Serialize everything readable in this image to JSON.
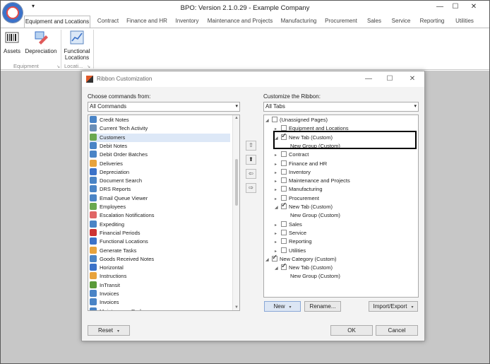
{
  "app": {
    "title": "BPO: Version 2.1.0.29 - Example Company",
    "qat_arrow": "▾",
    "window_controls": {
      "minimize": "—",
      "maximize": "☐",
      "close": "✕"
    }
  },
  "ribbon": {
    "tabs": [
      "Equipment and Locations",
      "Contract",
      "Finance and HR",
      "Inventory",
      "Maintenance and Projects",
      "Manufacturing",
      "Procurement",
      "Sales",
      "Service",
      "Reporting",
      "Utilities"
    ],
    "buttons": {
      "assets": "Assets",
      "depreciation": "Depreciation",
      "functional_locations_1": "Functional",
      "functional_locations_2": "Locations"
    },
    "groups": {
      "equipment": "Equipment",
      "locations": "Locati..."
    },
    "launcher": "↘"
  },
  "dialog": {
    "title": "Ribbon Customization",
    "controls": {
      "minimize": "—",
      "maximize": "☐",
      "close": "✕"
    },
    "left_label": "Choose commands from:",
    "left_combo": "All Commands",
    "right_label": "Customize the Ribbon:",
    "right_combo": "All Tabs",
    "commands": [
      {
        "label": "Credit Notes",
        "color": "#4a84c6"
      },
      {
        "label": "Current Tech Activity",
        "color": "#6b8fb8"
      },
      {
        "label": "Customers",
        "color": "#6aa84f"
      },
      {
        "label": "Debit Notes",
        "color": "#4a84c6"
      },
      {
        "label": "Debit Order Batches",
        "color": "#4a84c6"
      },
      {
        "label": "Deliveries",
        "color": "#e8a33d"
      },
      {
        "label": "Depreciation",
        "color": "#3b72c9"
      },
      {
        "label": "Document Search",
        "color": "#4a84c6"
      },
      {
        "label": "DRS Reports",
        "color": "#4a84c6"
      },
      {
        "label": "Email Queue Viewer",
        "color": "#4a84c6"
      },
      {
        "label": "Employees",
        "color": "#6aa84f"
      },
      {
        "label": "Escalation Notifications",
        "color": "#e06666"
      },
      {
        "label": "Expediting",
        "color": "#4a84c6"
      },
      {
        "label": "Financial Periods",
        "color": "#cc3333"
      },
      {
        "label": "Functional Locations",
        "color": "#3b72c9"
      },
      {
        "label": "Generate Tasks",
        "color": "#e8a33d"
      },
      {
        "label": "Goods Received Notes",
        "color": "#4a84c6"
      },
      {
        "label": "Horizontal",
        "color": "#3b72c9"
      },
      {
        "label": "Instructions",
        "color": "#e8a33d"
      },
      {
        "label": "InTransit",
        "color": "#5a9a3a"
      },
      {
        "label": "Invoices",
        "color": "#4a84c6"
      },
      {
        "label": "Invoices",
        "color": "#4a84c6"
      },
      {
        "label": "Maintenance Radar",
        "color": "#4a84c6"
      }
    ],
    "move_buttons": {
      "up_top": "⇧",
      "up": "⬆",
      "left": "⇦",
      "right": "⇨"
    },
    "tree": [
      {
        "label": "(Unassigned Pages)",
        "level": 0,
        "expander": "◢",
        "checked": false,
        "checkbox": true
      },
      {
        "label": "Equipment and Locations",
        "level": 1,
        "expander": "▸",
        "checked": false,
        "checkbox": true
      },
      {
        "label": "New Tab (Custom)",
        "level": 1,
        "expander": "◢",
        "checked": true,
        "checkbox": true
      },
      {
        "label": "New Group (Custom)",
        "level": 2,
        "expander": "",
        "checked": false,
        "checkbox": false
      },
      {
        "label": "Contract",
        "level": 1,
        "expander": "▸",
        "checked": false,
        "checkbox": true
      },
      {
        "label": "Finance and HR",
        "level": 1,
        "expander": "▸",
        "checked": false,
        "checkbox": true
      },
      {
        "label": "Inventory",
        "level": 1,
        "expander": "▸",
        "checked": false,
        "checkbox": true
      },
      {
        "label": "Maintenance and Projects",
        "level": 1,
        "expander": "▸",
        "checked": false,
        "checkbox": true
      },
      {
        "label": "Manufacturing",
        "level": 1,
        "expander": "▸",
        "checked": false,
        "checkbox": true
      },
      {
        "label": "Procurement",
        "level": 1,
        "expander": "▸",
        "checked": false,
        "checkbox": true
      },
      {
        "label": "New Tab (Custom)",
        "level": 1,
        "expander": "◢",
        "checked": true,
        "checkbox": true
      },
      {
        "label": "New Group (Custom)",
        "level": 2,
        "expander": "",
        "checked": false,
        "checkbox": false
      },
      {
        "label": "Sales",
        "level": 1,
        "expander": "▸",
        "checked": false,
        "checkbox": true
      },
      {
        "label": "Service",
        "level": 1,
        "expander": "▸",
        "checked": false,
        "checkbox": true
      },
      {
        "label": "Reporting",
        "level": 1,
        "expander": "▸",
        "checked": false,
        "checkbox": true
      },
      {
        "label": "Utilities",
        "level": 1,
        "expander": "▸",
        "checked": false,
        "checkbox": true
      },
      {
        "label": "New Category (Custom)",
        "level": 0,
        "expander": "◢",
        "checked": true,
        "checkbox": true
      },
      {
        "label": "New Tab (Custom)",
        "level": 1,
        "expander": "◢",
        "checked": true,
        "checkbox": true
      },
      {
        "label": "New Group (Custom)",
        "level": 2,
        "expander": "",
        "checked": false,
        "checkbox": false
      }
    ],
    "buttons": {
      "new": "New",
      "rename": "Rename...",
      "import_export": "Import/Export",
      "reset": "Reset",
      "ok": "OK",
      "cancel": "Cancel",
      "dropdown": "▾"
    }
  }
}
